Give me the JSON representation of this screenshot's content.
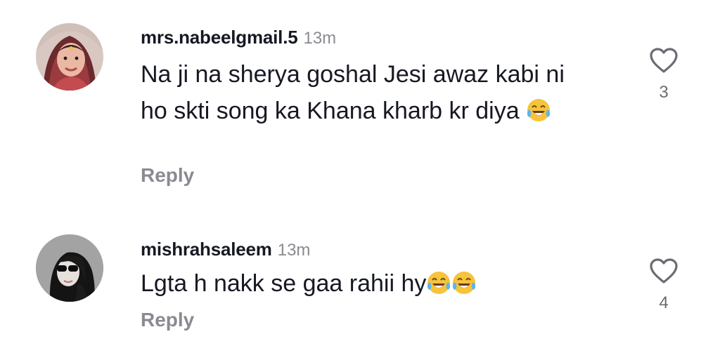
{
  "comments": [
    {
      "username": "mrs.nabeelgmail.5",
      "time": "13m",
      "text": "Na ji na sherya goshal Jesi awaz kabi ni ho skti song ka Khana kharb kr diya",
      "emoji": "face-with-tears-of-joy-icon",
      "reply_label": "Reply",
      "likes": "3"
    },
    {
      "username": "mishrahsaleem",
      "time": "13m",
      "text": "Lgta h nakk se gaa rahii hy",
      "emoji": "face-with-tears-of-joy-icon",
      "reply_label": "Reply",
      "likes": "4"
    }
  ],
  "colors": {
    "username": "#161823",
    "secondary": "#8a8b91",
    "icon": "#6b6c72"
  }
}
